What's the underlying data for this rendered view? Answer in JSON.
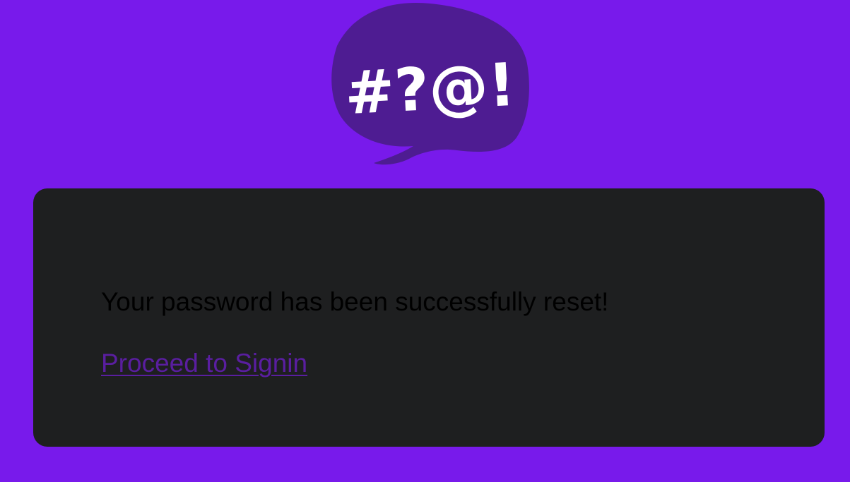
{
  "logo": {
    "icon": "speech-bubble-symbols-icon",
    "text": "#?@!",
    "bubble_color": "#4e1c92",
    "text_color": "#ffffff"
  },
  "colors": {
    "background": "#781aeb",
    "card": "#1e1f20",
    "message_text": "#000000",
    "link": "#5a1ea0"
  },
  "card": {
    "message": "Your password has been successfully reset!",
    "link_label": "Proceed to Signin"
  }
}
